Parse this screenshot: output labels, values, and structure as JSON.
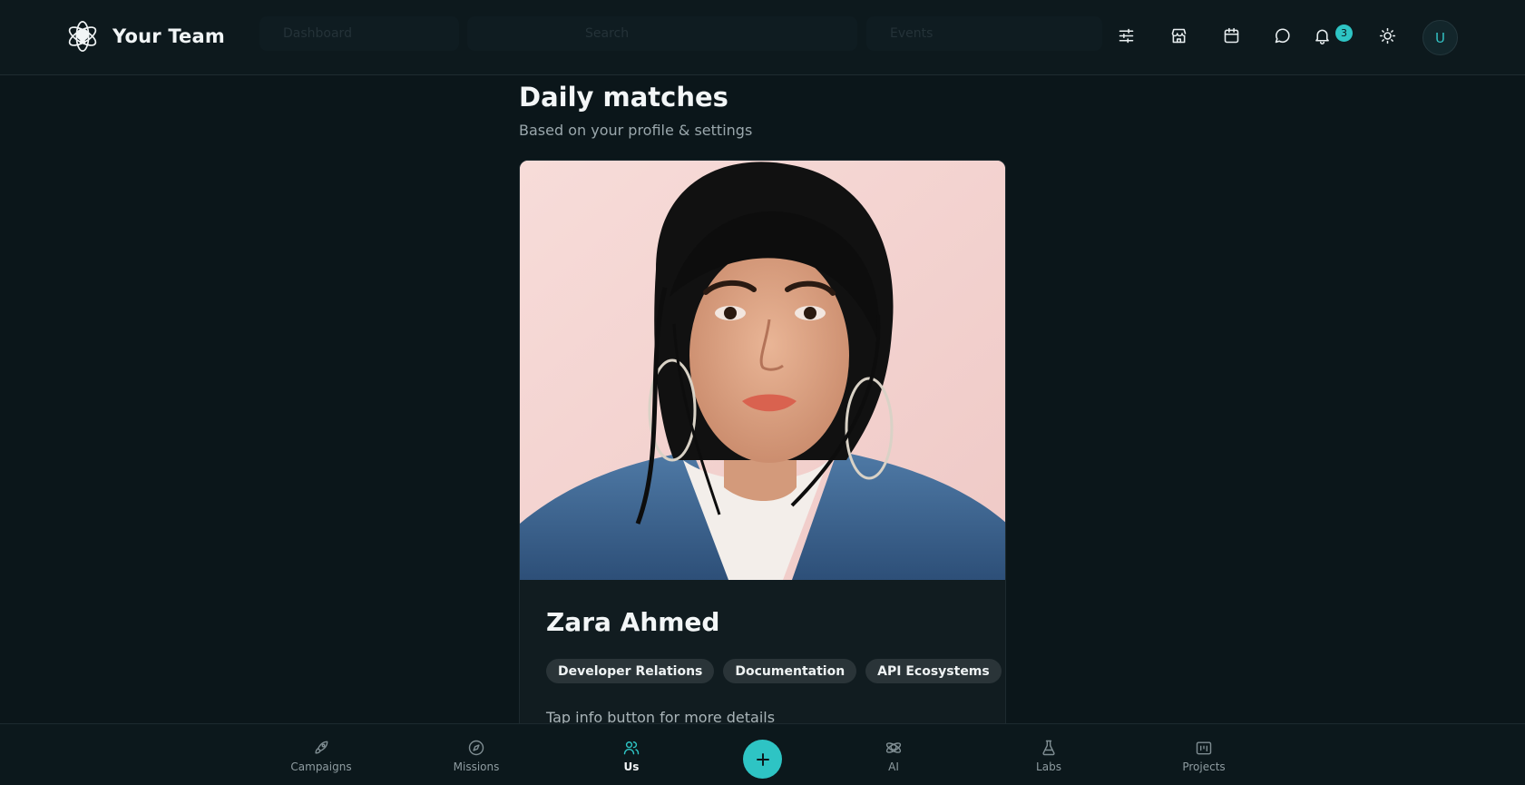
{
  "header": {
    "brand_name": "Your Team",
    "brand_icon": "lightbulb-atom-icon",
    "ghost_nav": [
      "Dashboard",
      "Search",
      "Events"
    ],
    "icons": [
      "sliders-icon",
      "store-icon",
      "calendar-icon",
      "chat-icon",
      "bell-icon",
      "sun-icon"
    ],
    "notification_count": "3",
    "avatar_initial": "U"
  },
  "main": {
    "title": "Daily matches",
    "subtitle": "Based on your profile & settings",
    "card": {
      "name": "Zara Ahmed",
      "tags": [
        "Developer Relations",
        "Documentation",
        "API Ecosystems"
      ],
      "hint": "Tap info button for more details"
    }
  },
  "bottom_nav": {
    "items": [
      {
        "label": "Campaigns",
        "icon": "rocket-icon"
      },
      {
        "label": "Missions",
        "icon": "compass-icon"
      },
      {
        "label": "Us",
        "icon": "users-icon"
      },
      {
        "label": "AI",
        "icon": "ai-brain-icon"
      },
      {
        "label": "Labs",
        "icon": "flask-icon"
      },
      {
        "label": "Projects",
        "icon": "folder-icon"
      }
    ],
    "active": "Us",
    "fab_icon": "plus-icon"
  },
  "colors": {
    "background": "#0b161a",
    "accent": "#2ec4c4",
    "card": "#111c20",
    "tag": "#2a3438"
  }
}
